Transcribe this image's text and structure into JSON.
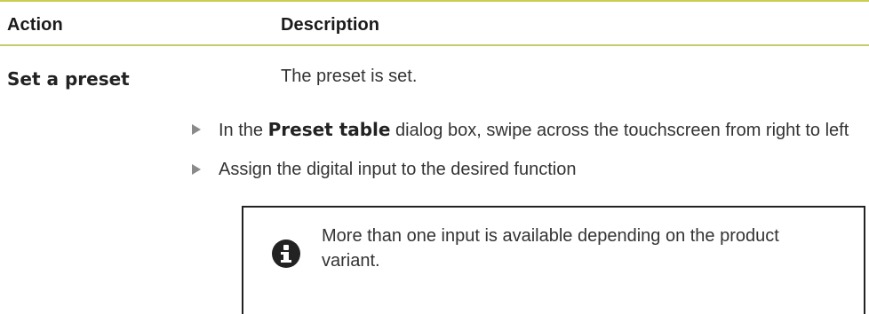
{
  "table": {
    "headers": {
      "action": "Action",
      "description": "Description"
    },
    "rows": [
      {
        "action": "Set a preset",
        "description": "The preset is set.",
        "steps": [
          {
            "before": "In the ",
            "ui_element": "Preset table",
            "after": " dialog box, swipe across the touchscreen from right to left"
          },
          {
            "text": "Assign the digital input to the desired function"
          }
        ],
        "note": {
          "icon": "info-icon",
          "text": "More than one input is available depending on the product variant."
        }
      }
    ]
  },
  "colors": {
    "header_rule": "#c9cc5a",
    "text": "#333333",
    "bullet_arrow": "#8a8a8a"
  }
}
